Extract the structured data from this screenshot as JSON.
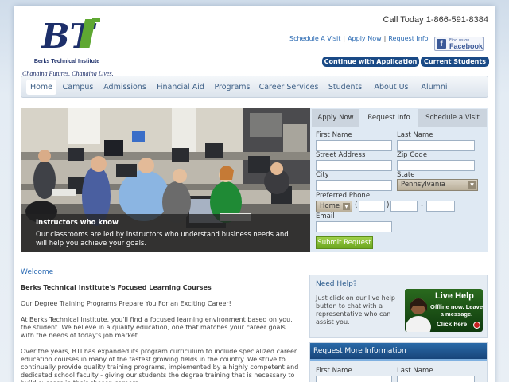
{
  "brand": {
    "logo_text": "BTi",
    "name": "Berks Technical Institute",
    "tagline": "Changing Futures. Changing Lives.",
    "colors": {
      "navy": "#1d2f6a",
      "green": "#5fa832"
    }
  },
  "header": {
    "phone": "Call Today 1-866-591-8384",
    "links": [
      "Schedule A Visit",
      "Apply Now",
      "Request Info"
    ],
    "facebook": {
      "line1": "Find us on",
      "line2": "Facebook",
      "icon": "facebook-icon"
    },
    "buttons": [
      "Continue with Application",
      "Current Students"
    ]
  },
  "nav": {
    "items": [
      "Home",
      "Campus",
      "Admissions",
      "Financial Aid",
      "Programs",
      "Career Services",
      "Students",
      "About Us",
      "Alumni"
    ],
    "active": "Home"
  },
  "hero": {
    "caption_title": "Instructors who know",
    "caption_text": "Our classrooms are led by instructors who understand business needs and will help you achieve your goals."
  },
  "form": {
    "tabs": [
      "Apply Now",
      "Request Info",
      "Schedule a Visit"
    ],
    "active_tab": "Request Info",
    "first_name_label": "First Name",
    "last_name_label": "Last Name",
    "street_label": "Street Address",
    "zip_label": "Zip Code",
    "city_label": "City",
    "state_label": "State",
    "state_value": "Pennsylvania",
    "phone_label": "Preferred Phone",
    "phone_type": "Home",
    "email_label": "Email",
    "submit": "Submit Request"
  },
  "content": {
    "welcome": "Welcome",
    "heading": "Berks Technical Institute's Focused Learning Courses",
    "p1": "Our Degree Training Programs Prepare You For an Exciting Career!",
    "p2": "At Berks Technical Institute, you'll find a focused learning environment based on you, the student. We believe in a quality education, one that matches your career goals with the needs of today's job market.",
    "p3": "Over the years, BTI has expanded its program curriculum to include specialized career education courses in many of the fastest growing fields in the country. We strive to continually provide quality training programs, implemented by a highly competent and dedicated school faculty - giving our students the degree training that is necessary to build success in their chosen careers."
  },
  "help": {
    "title": "Need Help?",
    "text": "Just click on our live help button to chat with a representative who can assist you.",
    "live_title": "Live Help",
    "live_sub": "Offline now. Leave a message.",
    "click": "Click here"
  },
  "request": {
    "title": "Request More Information",
    "first_name_label": "First Name",
    "last_name_label": "Last Name"
  }
}
